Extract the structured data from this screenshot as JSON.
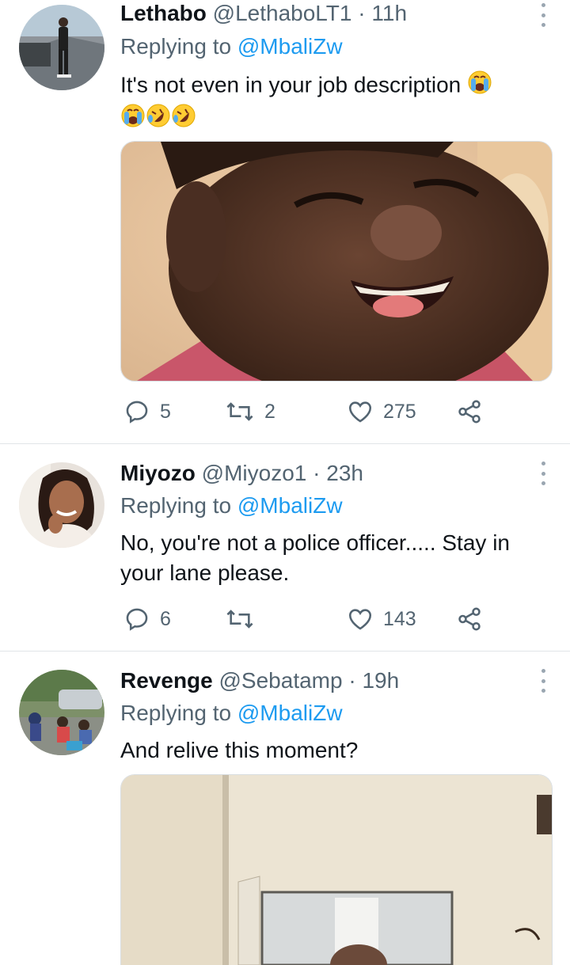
{
  "tweets": [
    {
      "name": "Lethabo",
      "handle": "@LethaboLT1",
      "separator": "·",
      "time": "11h",
      "replying_prefix": "Replying to",
      "replying_to": "@MbaliZw",
      "text": "It's not even in your job description",
      "emojis": [
        "crying-face",
        "crying-face",
        "rolling-laughing-face",
        "rolling-laughing-face"
      ],
      "media": "photo of a crying child",
      "replies": "5",
      "retweets": "2",
      "likes": "275"
    },
    {
      "name": "Miyozo",
      "handle": "@Miyozo1",
      "separator": "·",
      "time": "23h",
      "replying_prefix": "Replying to",
      "replying_to": "@MbaliZw",
      "text": "No, you're not a police officer..... Stay in your lane please.",
      "replies": "6",
      "retweets": "",
      "likes": "143"
    },
    {
      "name": "Revenge",
      "handle": "@Sebatamp",
      "separator": "·",
      "time": "19h",
      "replying_prefix": "Replying to",
      "replying_to": "@MbaliZw",
      "text": "And relive this moment?",
      "media": "photo of a room with a door"
    }
  ],
  "colors": {
    "link": "#1d9bf0",
    "secondary_text": "#536471",
    "primary_text": "#0f1419",
    "divider": "#e1e5e8"
  },
  "icons": [
    "reply-icon",
    "retweet-icon",
    "like-icon",
    "share-icon",
    "more-icon"
  ]
}
